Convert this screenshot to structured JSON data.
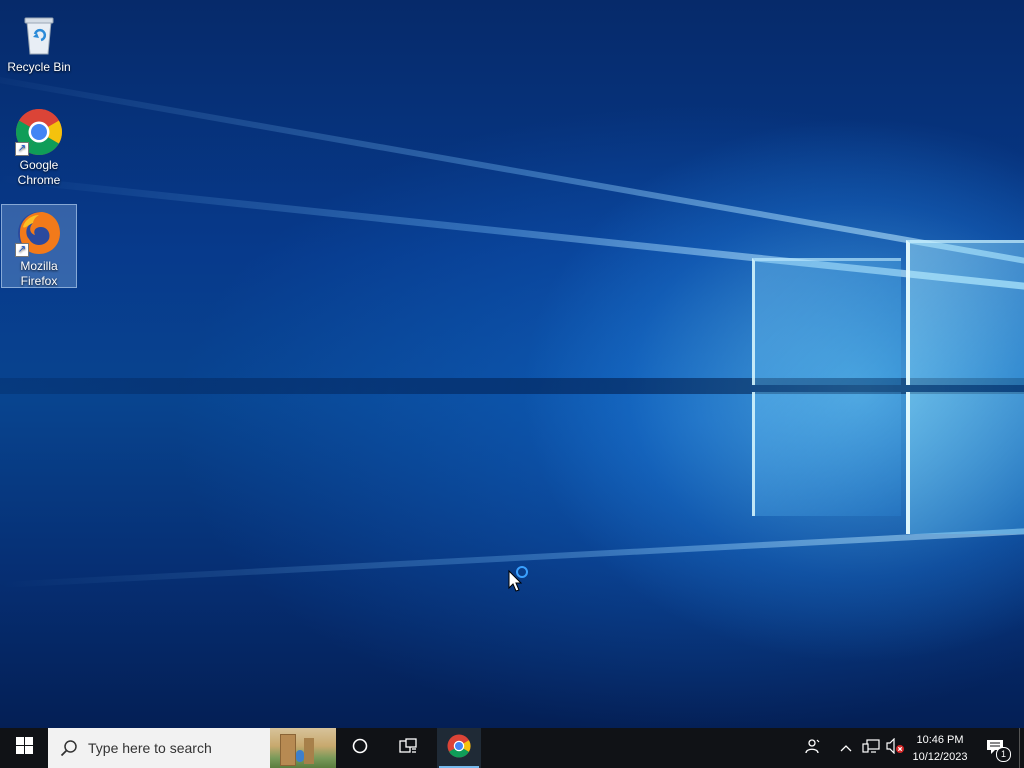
{
  "desktop": {
    "icons": [
      {
        "label_line1": "Recycle Bin",
        "label_line2": "",
        "icon": "recycle-bin-icon",
        "selected": false
      },
      {
        "label_line1": "Google",
        "label_line2": "Chrome",
        "icon": "chrome-icon",
        "selected": false
      },
      {
        "label_line1": "Mozilla",
        "label_line2": "Firefox",
        "icon": "firefox-icon",
        "selected": true
      }
    ]
  },
  "taskbar": {
    "start_icon": "windows-logo-icon",
    "search": {
      "placeholder": "Type here to search",
      "icon": "search-icon"
    },
    "cortana_icon": "cortana-circle-icon",
    "task_view_icon": "task-view-icon",
    "pinned_apps": [
      {
        "name": "Google Chrome",
        "icon": "chrome-icon",
        "active": true
      }
    ],
    "tray": {
      "people_icon": "people-icon",
      "show_hidden_icon": "chevron-up-icon",
      "network_icon": "network-icon",
      "volume_icon": "volume-muted-icon",
      "time": "10:46 PM",
      "date": "10/12/2023",
      "notifications_count": "1",
      "notifications_icon": "action-center-icon"
    }
  },
  "colors": {
    "taskbar": "#101216",
    "accent": "#0078d7",
    "desktop": "#073a8c"
  }
}
